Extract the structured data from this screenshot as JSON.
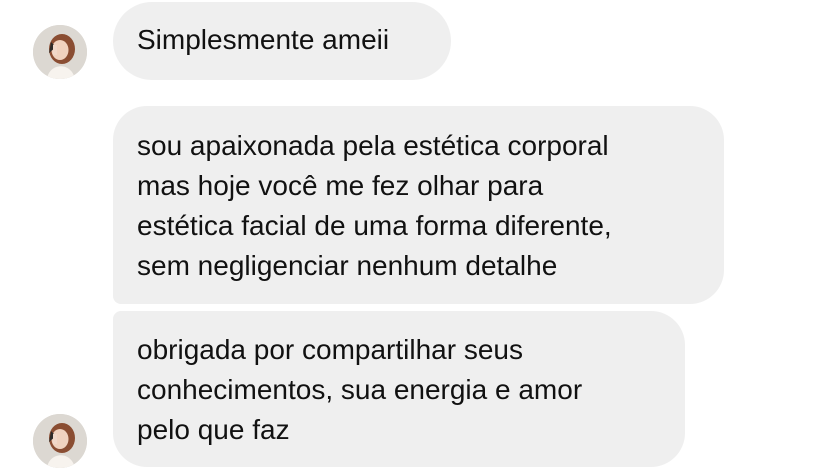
{
  "messages": [
    {
      "lines": [
        "Simplesmente ameii"
      ]
    },
    {
      "lines": [
        "sou apaixonada pela estética corporal",
        "mas hoje você me fez olhar para",
        "estética facial de uma forma diferente,",
        "sem negligenciar nenhum detalhe"
      ]
    },
    {
      "lines": [
        "obrigada por compartilhar seus",
        "conhecimentos, sua energia e amor",
        "pelo que faz"
      ]
    }
  ],
  "avatar_icon": "profile-photo",
  "colors": {
    "bubble_background": "#efefef",
    "text": "#111111",
    "page_background": "#ffffff"
  }
}
